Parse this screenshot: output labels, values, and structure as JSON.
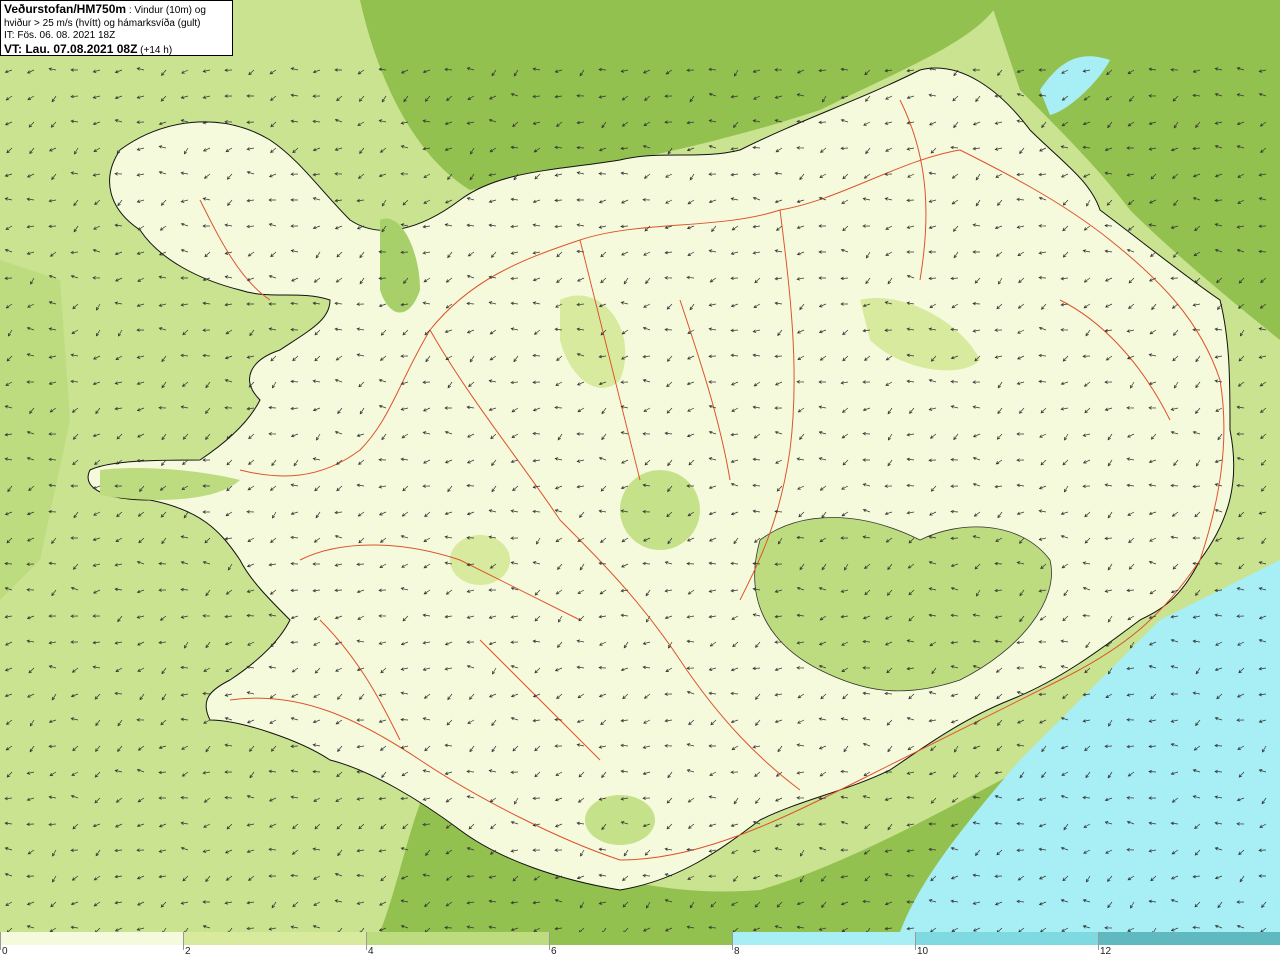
{
  "header": {
    "source": "Veðurstofan/HM750m",
    "line1_rest": " : Vindur (10m) og",
    "line2": "hviður > 25 m/s (hvítt) og hámarksvíða (gult)",
    "it": "IT: Fös. 06. 08. 2021 18Z",
    "vt_label": "VT: Lau. 07.08.2021 08Z",
    "vt_offset": " (+14 h)"
  },
  "legend": {
    "labels": [
      "0",
      "2",
      "4",
      "6",
      "8",
      "10",
      "12"
    ],
    "colors": [
      "#f5fadc",
      "#d7ea9e",
      "#bddc7f",
      "#93c150",
      "#a8eef5",
      "#7fd9e0",
      "#5fb9be"
    ]
  },
  "map": {
    "land_fill": "#f5fadc",
    "sea_green": "#9acb5a",
    "cyan": "#a8eef5",
    "coast_color": "#111111",
    "road_color": "#e0522a"
  }
}
